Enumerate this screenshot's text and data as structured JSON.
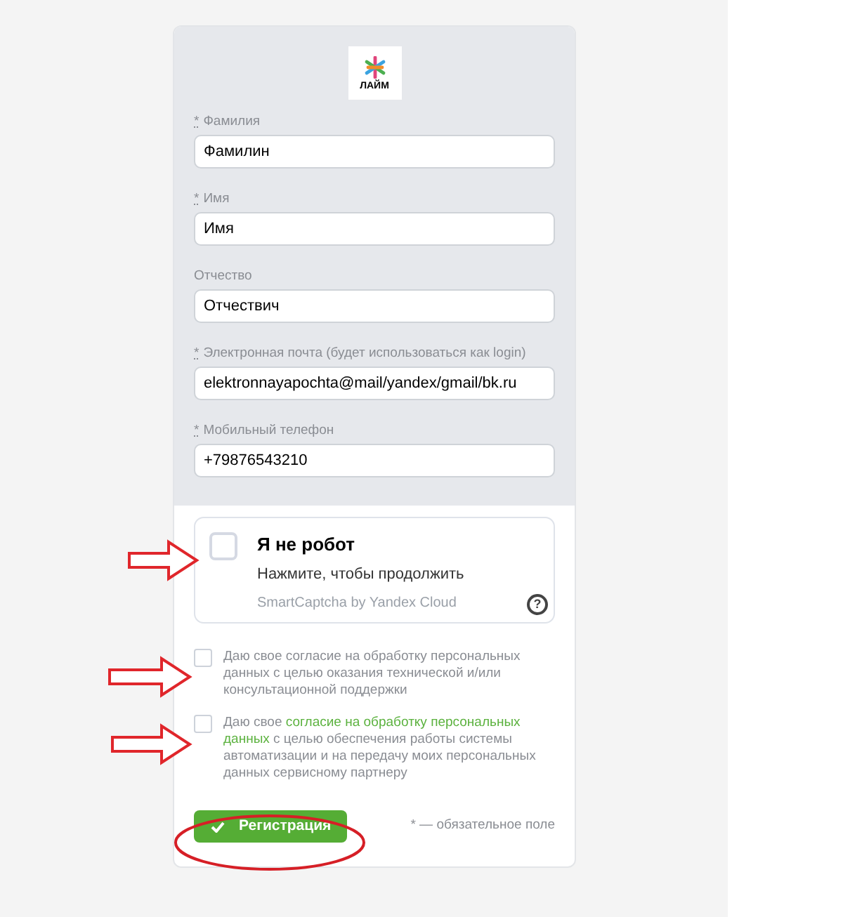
{
  "logo": {
    "text": "ЛАЙМ"
  },
  "fields": [
    {
      "label": "Фамилия",
      "required": true,
      "value": "Фамилин"
    },
    {
      "label": "Имя",
      "required": true,
      "value": "Имя"
    },
    {
      "label": "Отчество",
      "required": false,
      "value": "Отчествич"
    },
    {
      "label": "Электронная почта (будет использоваться как login)",
      "required": true,
      "value": "elektronnayapochta@mail/yandex/gmail/bk.ru"
    },
    {
      "label": "Мобильный телефон",
      "required": true,
      "value": "+79876543210"
    }
  ],
  "required_mark": "*",
  "captcha": {
    "checked": false,
    "title": "Я не робот",
    "subtitle": "Нажмите, чтобы продолжить",
    "brand": "SmartCaptcha by Yandex Cloud",
    "help": "?"
  },
  "consents": [
    {
      "checked": false,
      "segments": [
        {
          "text": "Даю свое согласие на обработку персональных данных с целью оказания технической и/или консультационной поддержки",
          "link": false
        }
      ]
    },
    {
      "checked": false,
      "segments": [
        {
          "text": "Даю свое",
          "link": false
        },
        {
          "text": "согласие на обработку персональных",
          "link": true
        },
        {
          "text": "данных",
          "link": true
        },
        {
          "text": "с целью обеспечения работы системы автоматизации и на передачу моих персональных данных сервисному партнеру",
          "link": false
        }
      ]
    }
  ],
  "submit": {
    "label": "Регистрация"
  },
  "required_note": "* — обязательное поле",
  "annotations": [
    {
      "kind": "arrow"
    },
    {
      "kind": "arrow"
    },
    {
      "kind": "arrow"
    },
    {
      "kind": "ellipse"
    }
  ]
}
